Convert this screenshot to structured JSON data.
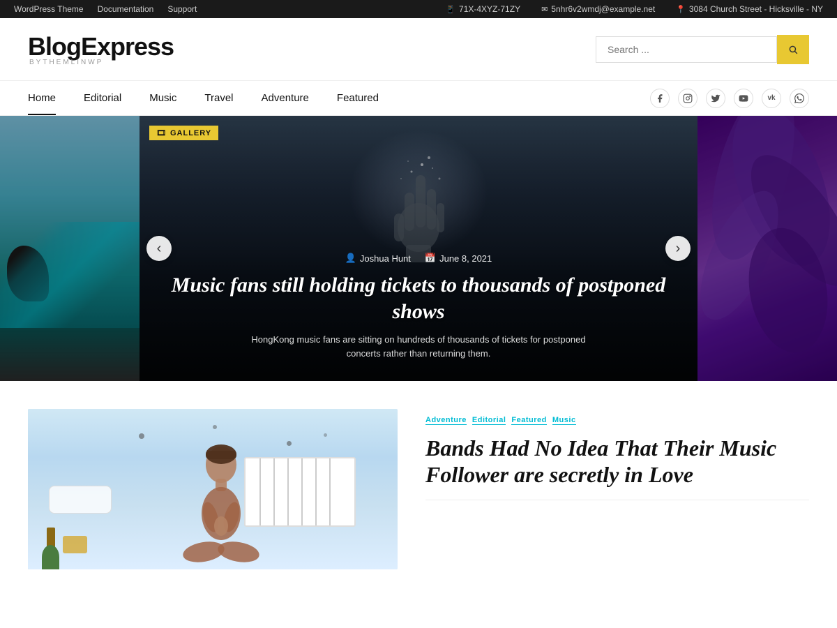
{
  "topbar": {
    "left_links": [
      "WordPress Theme",
      "Documentation",
      "Support"
    ],
    "phone": "71X-4XYZ-71ZY",
    "email": "5nhr6v2wmdj@example.net",
    "address": "3084 Church Street - Hicksville - NY"
  },
  "header": {
    "logo_text": "BlogExpress",
    "logo_sub": "byTHEMLINWP",
    "search_placeholder": "Search ..."
  },
  "nav": {
    "links": [
      {
        "label": "Home",
        "active": true
      },
      {
        "label": "Editorial",
        "active": false
      },
      {
        "label": "Music",
        "active": false
      },
      {
        "label": "Travel",
        "active": false
      },
      {
        "label": "Adventure",
        "active": false
      },
      {
        "label": "Featured",
        "active": false
      }
    ],
    "social": [
      "f",
      "ig",
      "tw",
      "yt",
      "vk",
      "wa"
    ]
  },
  "hero": {
    "tag": "GALLERY",
    "author": "Joshua Hunt",
    "date": "June 8, 2021",
    "title": "Music fans still holding tickets to thousands of postponed shows",
    "description": "HongKong music fans are sitting on hundreds of thousands of tickets for postponed concerts rather than returning them."
  },
  "article": {
    "tags": [
      "Adventure",
      "Editorial",
      "Featured",
      "Music"
    ],
    "title": "Bands Had No Idea That Their Music Follower are secretly in Love"
  },
  "search_button": "🔍",
  "arrow_left": "‹",
  "arrow_right": "›",
  "icons": {
    "phone": "📱",
    "email": "✉",
    "location": "📍",
    "user": "👤",
    "calendar": "📅",
    "camera": "🎞"
  }
}
